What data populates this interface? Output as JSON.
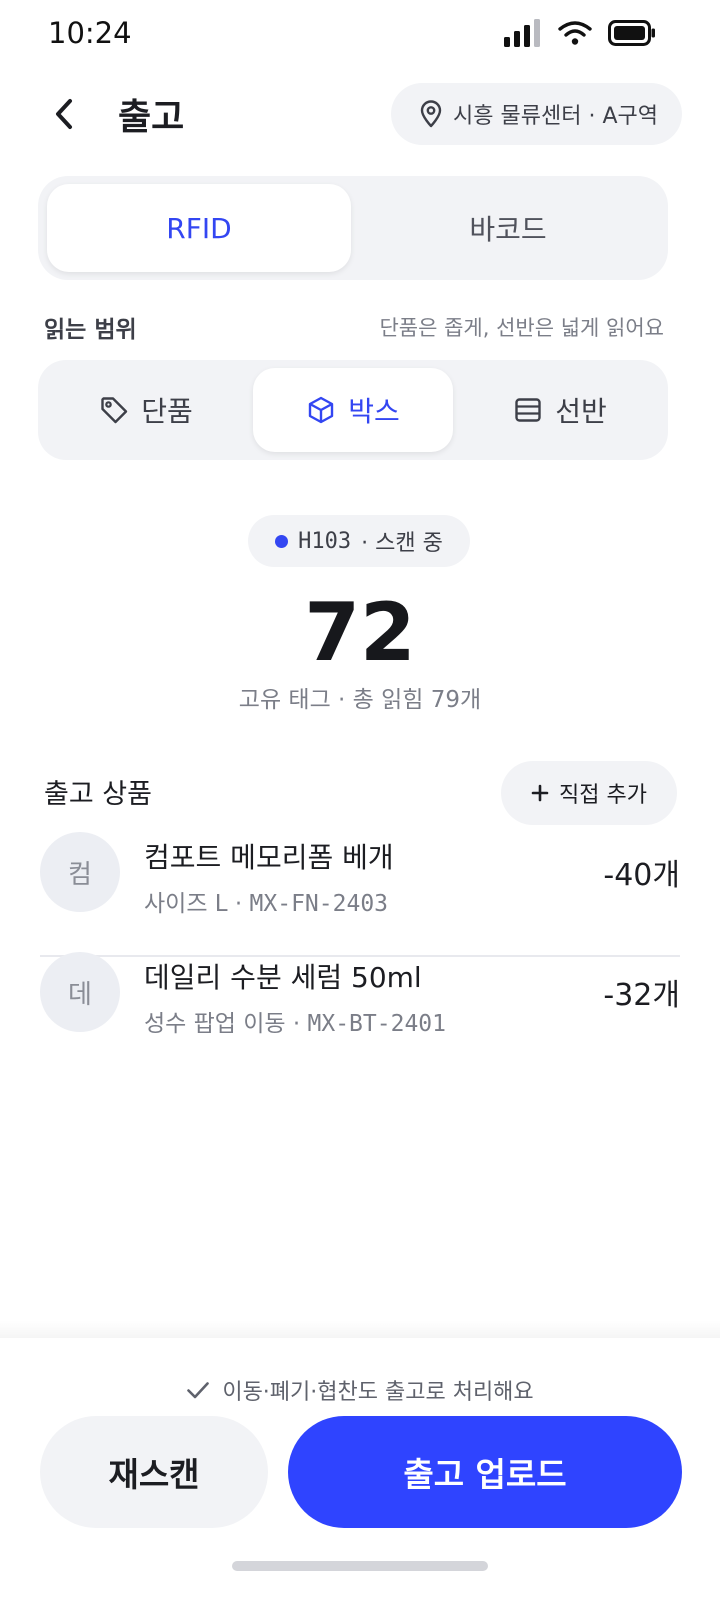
{
  "status_bar": {
    "time": "10:24"
  },
  "header": {
    "title": "출고",
    "location": "시흥 물류센터 · A구역"
  },
  "mode_tabs": [
    {
      "label": "RFID",
      "active": true
    },
    {
      "label": "바코드",
      "active": false
    }
  ],
  "read_range": {
    "label": "읽는 범위",
    "hint": "단품은 좁게, 선반은 넓게 읽어요",
    "options": [
      {
        "label": "단품",
        "icon": "tag-icon",
        "active": false
      },
      {
        "label": "박스",
        "icon": "box-icon",
        "active": true
      },
      {
        "label": "선반",
        "icon": "shelf-icon",
        "active": false
      }
    ]
  },
  "scan": {
    "code": "H103",
    "status": "· 스캔 중",
    "count": "72",
    "sub": "고유 태그 · 총 읽힘 79개"
  },
  "products": {
    "title": "출고 상품",
    "add_label": "직접 추가",
    "items": [
      {
        "avatar": "컴",
        "name": "컴포트 메모리폼 베개",
        "meta_prefix": "사이즈 L · ",
        "sku": "MX-FN-2403",
        "qty": "-40개"
      },
      {
        "avatar": "데",
        "name": "데일리 수분 세럼 50ml",
        "meta_prefix": "성수 팝업 이동 · ",
        "sku": "MX-BT-2401",
        "qty": "-32개"
      }
    ]
  },
  "footer": {
    "notice": "이동·폐기·협찬도 출고로 처리해요",
    "rescan_label": "재스캔",
    "upload_label": "출고 업로드"
  },
  "colors": {
    "accent": "#2f44ff",
    "surface": "#f2f3f6"
  }
}
